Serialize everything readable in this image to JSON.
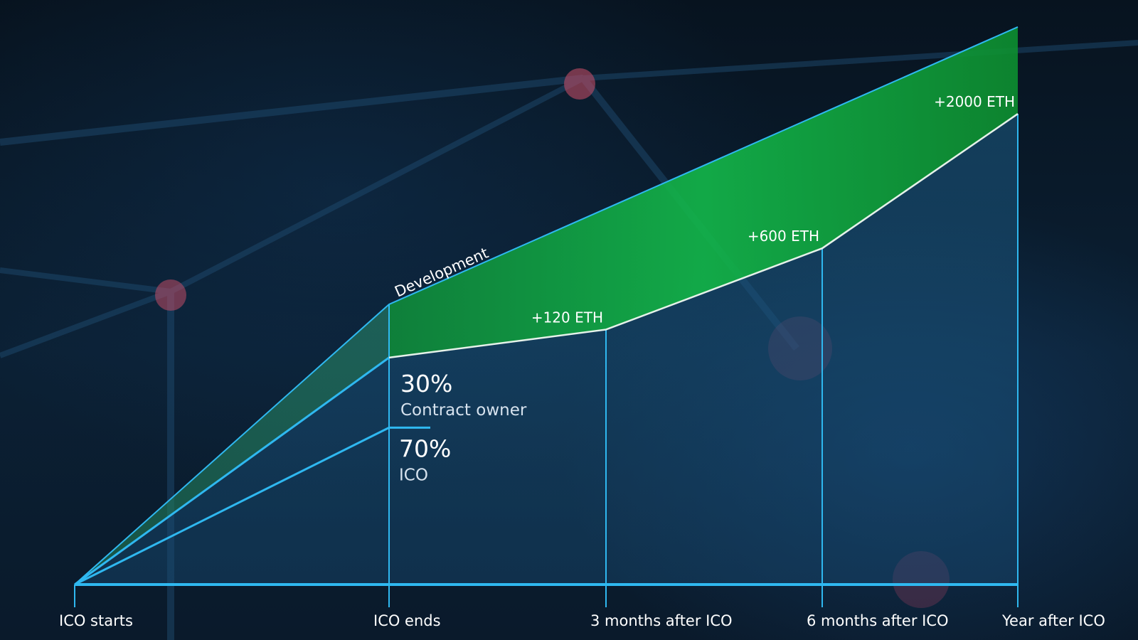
{
  "colors": {
    "line": "#2fb8f0",
    "green": "#0fa838",
    "white_line": "#e6f2ea",
    "text": "#ffffff"
  },
  "chart_data": {
    "type": "area",
    "title": "",
    "categories": [
      "ICO starts",
      "ICO ends",
      "3 months after ICO",
      "6 months after ICO",
      "Year after ICO"
    ],
    "series": [
      {
        "name": "Development",
        "values": [
          0,
          100,
          null,
          null,
          199
        ]
      },
      {
        "name": "",
        "values": [
          0,
          81,
          91,
          120,
          168
        ]
      },
      {
        "name": "",
        "values": [
          0,
          56,
          null,
          null,
          null
        ]
      }
    ],
    "eth_labels": [
      {
        "category": "3 months after ICO",
        "text": "+120 ETH"
      },
      {
        "category": "6 months after ICO",
        "text": "+600 ETH"
      },
      {
        "category": "Year after ICO",
        "text": "+2000 ETH"
      }
    ],
    "split_labels": {
      "owner_pct": "30%",
      "owner_label": "Contract owner",
      "ico_pct": "70%",
      "ico_label": "ICO"
    },
    "development_label": "Development",
    "ylim": [
      0,
      200
    ],
    "grid": false,
    "legend": "none"
  }
}
